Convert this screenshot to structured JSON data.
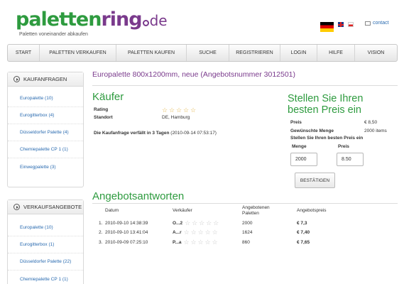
{
  "header": {
    "logo": {
      "part1": "paletten",
      "part2": "ring",
      "part3": "de"
    },
    "tagline": "Paletten voneinander abkaufen",
    "contact_label": "contact",
    "colors": {
      "green": "#2e9b3f",
      "purple": "#7a3a8c",
      "link": "#2a6bb0"
    }
  },
  "nav": {
    "items": [
      "START",
      "PALETTEN VERKAUFEN",
      "PALETTEN KAUFEN",
      "SUCHE",
      "REGISTRIEREN",
      "LOGIN",
      "HILFE",
      "VISION"
    ]
  },
  "sidebar": {
    "requests": {
      "title": "KAUFANFRAGEN",
      "items": [
        "Europalette (10)",
        "Eurogitterbox (4)",
        "Düsseldorfer Palette (4)",
        "Chemiepalette CP 1 (1)",
        "Einwegpalette (3)"
      ]
    },
    "offers": {
      "title": "VERKAUFSANGEBOTE",
      "items": [
        "Europalette (10)",
        "Eurogitterbox (1)",
        "Düsseldorfer Palette (22)",
        "Chemiepalette CP 1 (1)"
      ]
    }
  },
  "main": {
    "title": "Europalette 800x1200mm, neue (Angebotsnummer 3012501)",
    "buyer": {
      "heading": "Käufer",
      "rating_label": "Rating",
      "rating_stars": 5,
      "location_label": "Standort",
      "location_value": "DE, Hamburg",
      "expiry_prefix": "Die Kaufanfrage verfällt in",
      "expiry_days": "3 Tagen",
      "expiry_date": "(2010-09-14 07:53:17)"
    },
    "offer": {
      "heading": "Stellen Sie Ihren besten Preis ein",
      "price_label": "Preis",
      "price_value": "€ 8,50",
      "quantity_label": "Gewünschte Menge",
      "quantity_value": "2000 items",
      "own_price_label": "Stellen Sie Ihren besten Preis ein",
      "field_quantity_label": "Menge",
      "field_price_label": "Preis",
      "field_quantity_value": "2000",
      "field_price_value": "8.50",
      "confirm_label": "BESTÄTIGEN"
    },
    "answers": {
      "heading": "Angebotsantworten",
      "columns": {
        "date": "Datum",
        "seller": "Verkäufer",
        "offered_line1": "Angebotenen",
        "offered_line2": "Paletten",
        "price": "Angebotspreis"
      },
      "rows": [
        {
          "num": "1.",
          "date": "2010-09-10 14:38:39",
          "seller": "O...2",
          "pallets": "2000",
          "price": "€ 7,3"
        },
        {
          "num": "2.",
          "date": "2010-09-10 13:41:04",
          "seller": "A...r",
          "pallets": "1624",
          "price": "€ 7,40"
        },
        {
          "num": "3.",
          "date": "2010-09-09 07:25:10",
          "seller": "P...a",
          "pallets": "860",
          "price": "€ 7,65"
        }
      ]
    }
  }
}
